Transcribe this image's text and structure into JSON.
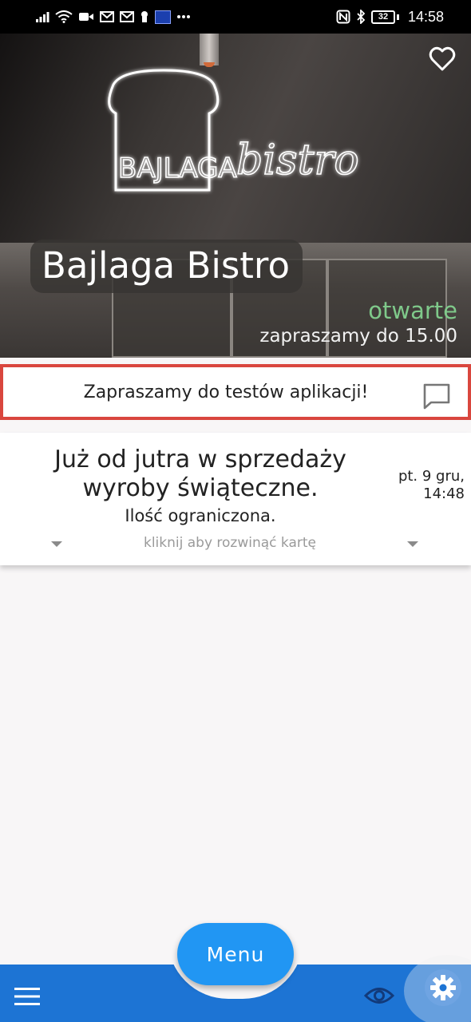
{
  "status_bar": {
    "time": "14:58",
    "battery": "32",
    "icons_left": [
      "signal-icon",
      "wifi-icon",
      "video-icon",
      "mail-icon",
      "mail-icon",
      "keyhole-icon",
      "keyboard-icon",
      "more-icon"
    ],
    "icons_right": [
      "nfc-icon",
      "bluetooth-icon",
      "battery-icon"
    ]
  },
  "hero": {
    "title": "Bajlaga Bistro",
    "status": "otwarte",
    "hours": "zapraszamy do 15.00",
    "neon_left": "BAJLAGA",
    "neon_right": "bistro"
  },
  "announcement": {
    "text": "Zapraszamy do testów aplikacji!"
  },
  "news_card": {
    "headline_line1": "Już od jutra w sprzedaży",
    "headline_line2": "wyroby świąteczne.",
    "subline": "Ilość ograniczona.",
    "date_line1": "pt. 9 gru,",
    "date_line2": "14:48",
    "expand_hint": "kliknij aby rozwinąć kartę"
  },
  "bottom_nav": {
    "menu_label": "Menu"
  },
  "colors": {
    "accent_blue": "#1d74d4",
    "fab_blue": "#2196f3",
    "open_green": "#7fc98a",
    "highlight_red": "#d9463e"
  }
}
